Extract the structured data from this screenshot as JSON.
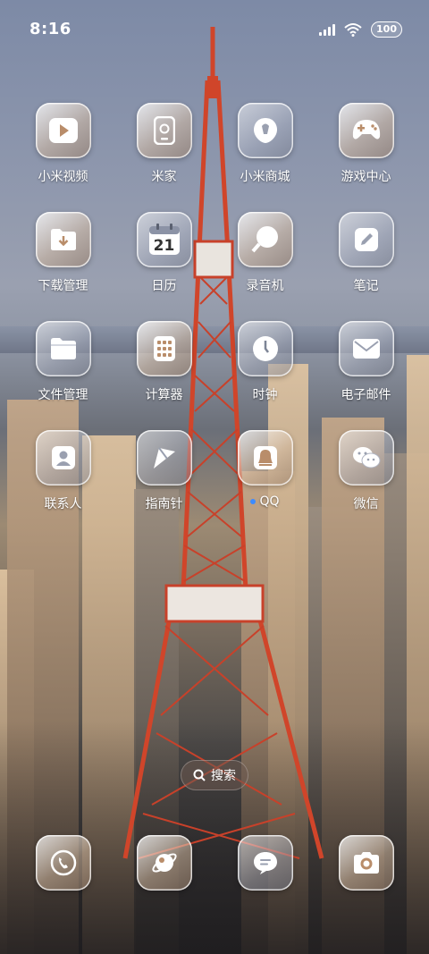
{
  "status_bar": {
    "time": "8:16",
    "battery": "100"
  },
  "apps": [
    {
      "label": "小米视频",
      "icon": "video-play-icon"
    },
    {
      "label": "米家",
      "icon": "mijia-device-icon"
    },
    {
      "label": "小米商城",
      "icon": "mi-store-icon"
    },
    {
      "label": "游戏中心",
      "icon": "gamepad-icon"
    },
    {
      "label": "下载管理",
      "icon": "download-folder-icon"
    },
    {
      "label": "日历",
      "icon": "calendar-icon",
      "calendar_day": "21"
    },
    {
      "label": "录音机",
      "icon": "recorder-icon"
    },
    {
      "label": "笔记",
      "icon": "note-pencil-icon"
    },
    {
      "label": "文件管理",
      "icon": "folder-icon"
    },
    {
      "label": "计算器",
      "icon": "calculator-icon"
    },
    {
      "label": "时钟",
      "icon": "clock-icon"
    },
    {
      "label": "电子邮件",
      "icon": "mail-envelope-icon"
    },
    {
      "label": "联系人",
      "icon": "contact-person-icon"
    },
    {
      "label": "指南针",
      "icon": "compass-icon"
    },
    {
      "label": "QQ",
      "icon": "qq-penguin-icon"
    },
    {
      "label": "微信",
      "icon": "wechat-icon"
    }
  ],
  "search": {
    "label": "搜索"
  },
  "dock": [
    {
      "icon": "phone-icon"
    },
    {
      "icon": "browser-planet-icon"
    },
    {
      "icon": "messages-bubble-icon"
    },
    {
      "icon": "camera-icon"
    }
  ]
}
